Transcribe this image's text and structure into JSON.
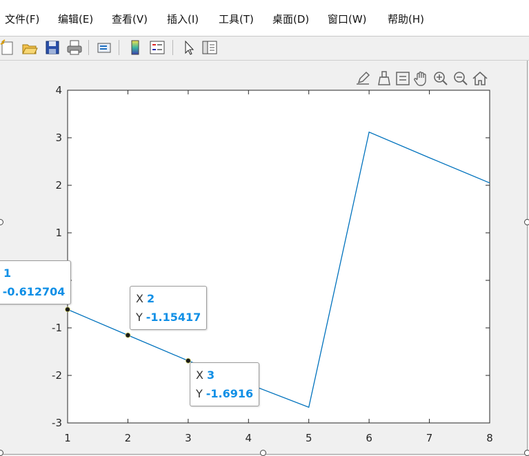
{
  "menu": [
    "文件(F)",
    "编辑(E)",
    "查看(V)",
    "插入(I)",
    "工具(T)",
    "桌面(D)",
    "窗口(W)",
    "帮助(H)"
  ],
  "toolbar_icons": [
    "new-figure-icon",
    "open-file-icon",
    "save-icon",
    "print-icon",
    "link-plot-icon",
    "colorbar-icon",
    "legend-icon",
    "pointer-icon",
    "property-inspector-icon"
  ],
  "axes_toolbar_icons": [
    "edit-plot-icon",
    "brush-icon",
    "data-tips-icon",
    "pan-hand-icon",
    "zoom-in-icon",
    "zoom-out-icon",
    "restore-view-icon"
  ],
  "chart_data": {
    "type": "line",
    "x": [
      1,
      2,
      3,
      4,
      5,
      6,
      7,
      8
    ],
    "y": [
      -0.612704,
      -1.15417,
      -1.6916,
      -2.18,
      -2.67,
      3.12,
      2.58,
      2.05
    ],
    "xlim": [
      1,
      8
    ],
    "ylim": [
      -3,
      4
    ],
    "xticks": [
      1,
      2,
      3,
      4,
      5,
      6,
      7,
      8
    ],
    "yticks": [
      -3,
      -2,
      -1,
      0,
      1,
      2,
      3,
      4
    ],
    "xtick_labels": [
      "1",
      "2",
      "3",
      "4",
      "5",
      "6",
      "7",
      "8"
    ],
    "ytick_labels": [
      "-3",
      "-2",
      "-1",
      "",
      "1",
      "2",
      "3",
      "4"
    ],
    "line_color": "#0072bd",
    "grid": false,
    "datatips": [
      {
        "x_label": "X",
        "x": "1",
        "y_label": "Y",
        "y": "-0.612704"
      },
      {
        "x_label": "X",
        "x": "2",
        "y_label": "Y",
        "y": "-1.15417"
      },
      {
        "x_label": "X",
        "x": "3",
        "y_label": "Y",
        "y": "-1.6916"
      }
    ]
  }
}
